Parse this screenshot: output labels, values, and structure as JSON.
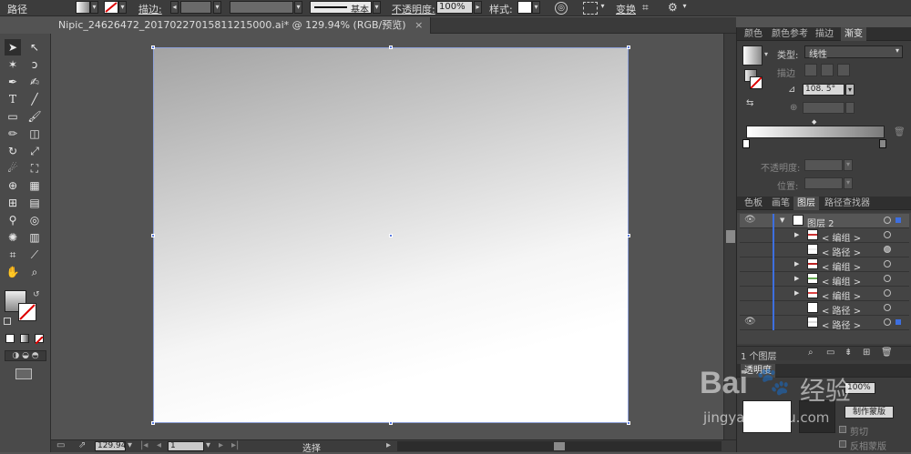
{
  "control_bar": {
    "object_type": "路径",
    "stroke_label": "描边:",
    "stroke_style": "基本",
    "opacity_label": "不透明度:",
    "opacity_value": "100%",
    "style_label": "样式:",
    "transform_label": "变换"
  },
  "document_tab": {
    "title": "Nipic_24626472_20170227015811215000.ai* @ 129.94% (RGB/预览)"
  },
  "status_bar": {
    "zoom": "129.94",
    "artboard": "1",
    "tool_name": "选择"
  },
  "gradient_panel": {
    "tabs": [
      "颜色",
      "颜色参考",
      "描边",
      "渐变"
    ],
    "active_tab": "渐变",
    "type_label": "类型:",
    "type_value": "线性",
    "stroke_label": "描边",
    "angle_value": "108. 5°",
    "opacity_label": "不透明度:",
    "location_label": "位置:"
  },
  "layers_panel": {
    "tabs": [
      "色板",
      "画笔",
      "图层",
      "路径查找器"
    ],
    "active_tab": "图层",
    "layer_name": "图层 2",
    "rows": [
      {
        "label": "< 编组 >",
        "expand": true
      },
      {
        "label": "< 路径 >",
        "expand": false
      },
      {
        "label": "< 编组 >",
        "expand": true
      },
      {
        "label": "< 编组 >",
        "expand": true
      },
      {
        "label": "< 编组 >",
        "expand": true
      },
      {
        "label": "< 路径 >",
        "expand": false
      },
      {
        "label": "< 路径 >",
        "expand": false
      }
    ],
    "footer_count": "1 个图层"
  },
  "transparency_panel": {
    "tab": "透明度",
    "opacity_value": "100%",
    "make_mask": "制作蒙版",
    "clip": "剪切",
    "invert_mask": "反相蒙版"
  },
  "watermark": {
    "brand": "Bai",
    "brand2": "经验",
    "url": "jingyan.baidu.com"
  }
}
